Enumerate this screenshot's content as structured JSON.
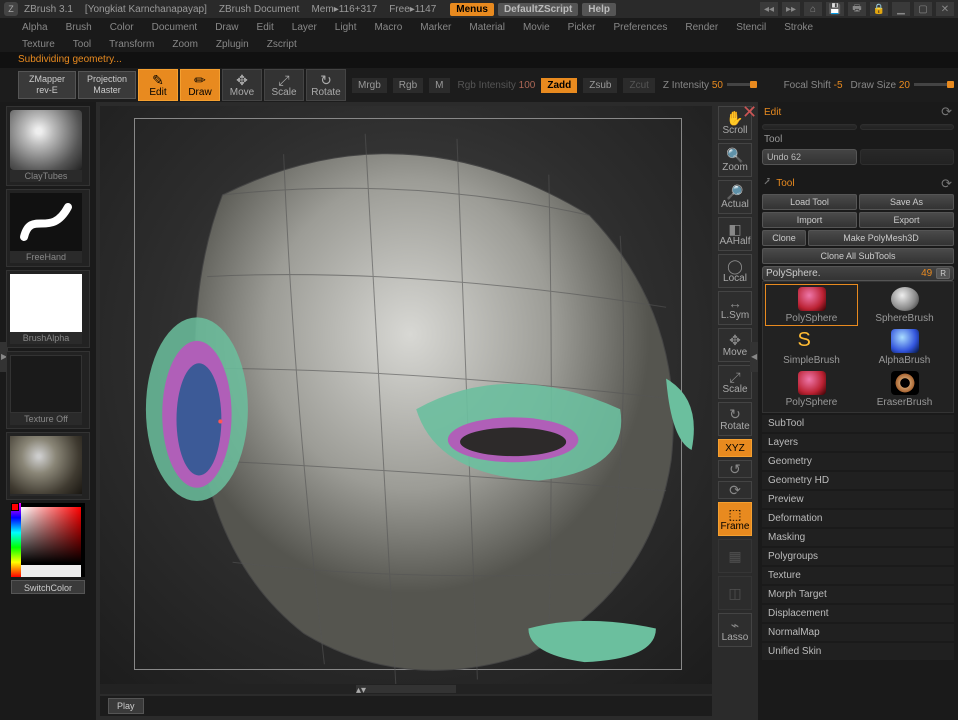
{
  "titlebar": {
    "app": "ZBrush 3.1",
    "doc_owner": "[Yongkiat Karnchanapayap]",
    "doc_name": "ZBrush Document",
    "mem": "Mem▸116+317",
    "free": "Free▸1147",
    "menus_btn": "Menus",
    "zscript_btn": "DefaultZScript",
    "help_btn": "Help"
  },
  "menus1": [
    "Alpha",
    "Brush",
    "Color",
    "Document",
    "Draw",
    "Edit",
    "Layer",
    "Light",
    "Macro",
    "Marker",
    "Material",
    "Movie",
    "Picker",
    "Preferences",
    "Render",
    "Stencil",
    "Stroke"
  ],
  "menus2": [
    "Texture",
    "Tool",
    "Transform",
    "Zoom",
    "Zplugin",
    "Zscript"
  ],
  "status_text": "Subdividing geometry...",
  "toolbar": {
    "zmapper": "ZMapper\nrev-E",
    "projection": "Projection\nMaster",
    "edit": "Edit",
    "draw": "Draw",
    "move": "Move",
    "scale": "Scale",
    "rotate": "Rotate",
    "mrgb": "Mrgb",
    "rgb": "Rgb",
    "m": "M",
    "rgb_int_label": "Rgb Intensity",
    "rgb_int_val": "100",
    "zadd": "Zadd",
    "zsub": "Zsub",
    "zcut": "Zcut",
    "z_int_label": "Z Intensity",
    "z_int_val": "50",
    "focal_label": "Focal Shift",
    "focal_val": "-5",
    "draw_size_label": "Draw Size",
    "draw_size_val": "20"
  },
  "left": {
    "brush_label": "ClayTubes",
    "stroke_label": "FreeHand",
    "alpha_label": "BrushAlpha",
    "tex_label": "Texture Off",
    "mat_label": "",
    "switch": "SwitchColor"
  },
  "rstrip": {
    "scroll": "Scroll",
    "zoom": "Zoom",
    "actual": "Actual",
    "aahalf": "AAHalf",
    "local": "Local",
    "lsym": "L.Sym",
    "move": "Move",
    "scale": "Scale",
    "rotate": "Rotate",
    "xyz": "XYZ",
    "frame": "Frame",
    "lasso": "Lasso"
  },
  "play_btn": "Play",
  "rpanel": {
    "edit_head": "Edit",
    "undo": "Undo 62",
    "tool_label": "Tool",
    "history": " ",
    "tool_head": "Tool",
    "load": "Load Tool",
    "saveas": "Save As",
    "import": "Import",
    "export": "Export",
    "clone": "Clone",
    "makepoly": "Make PolyMesh3D",
    "cloneall": "Clone All SubTools",
    "polyname": "PolySphere.",
    "polycount": "49",
    "r": "R",
    "brushes": {
      "polysphere": "PolySphere",
      "spherebrush": "SphereBrush",
      "alphabrush": "AlphaBrush",
      "simplebrush": "SimpleBrush",
      "eraserbrush": "EraserBrush",
      "polysphere2": "PolySphere"
    },
    "accordion": [
      "SubTool",
      "Layers",
      "Geometry",
      "Geometry HD",
      "Preview",
      "Deformation",
      "Masking",
      "Polygroups",
      "Texture",
      "Morph Target",
      "Displacement",
      "NormalMap",
      "Unified Skin"
    ]
  }
}
